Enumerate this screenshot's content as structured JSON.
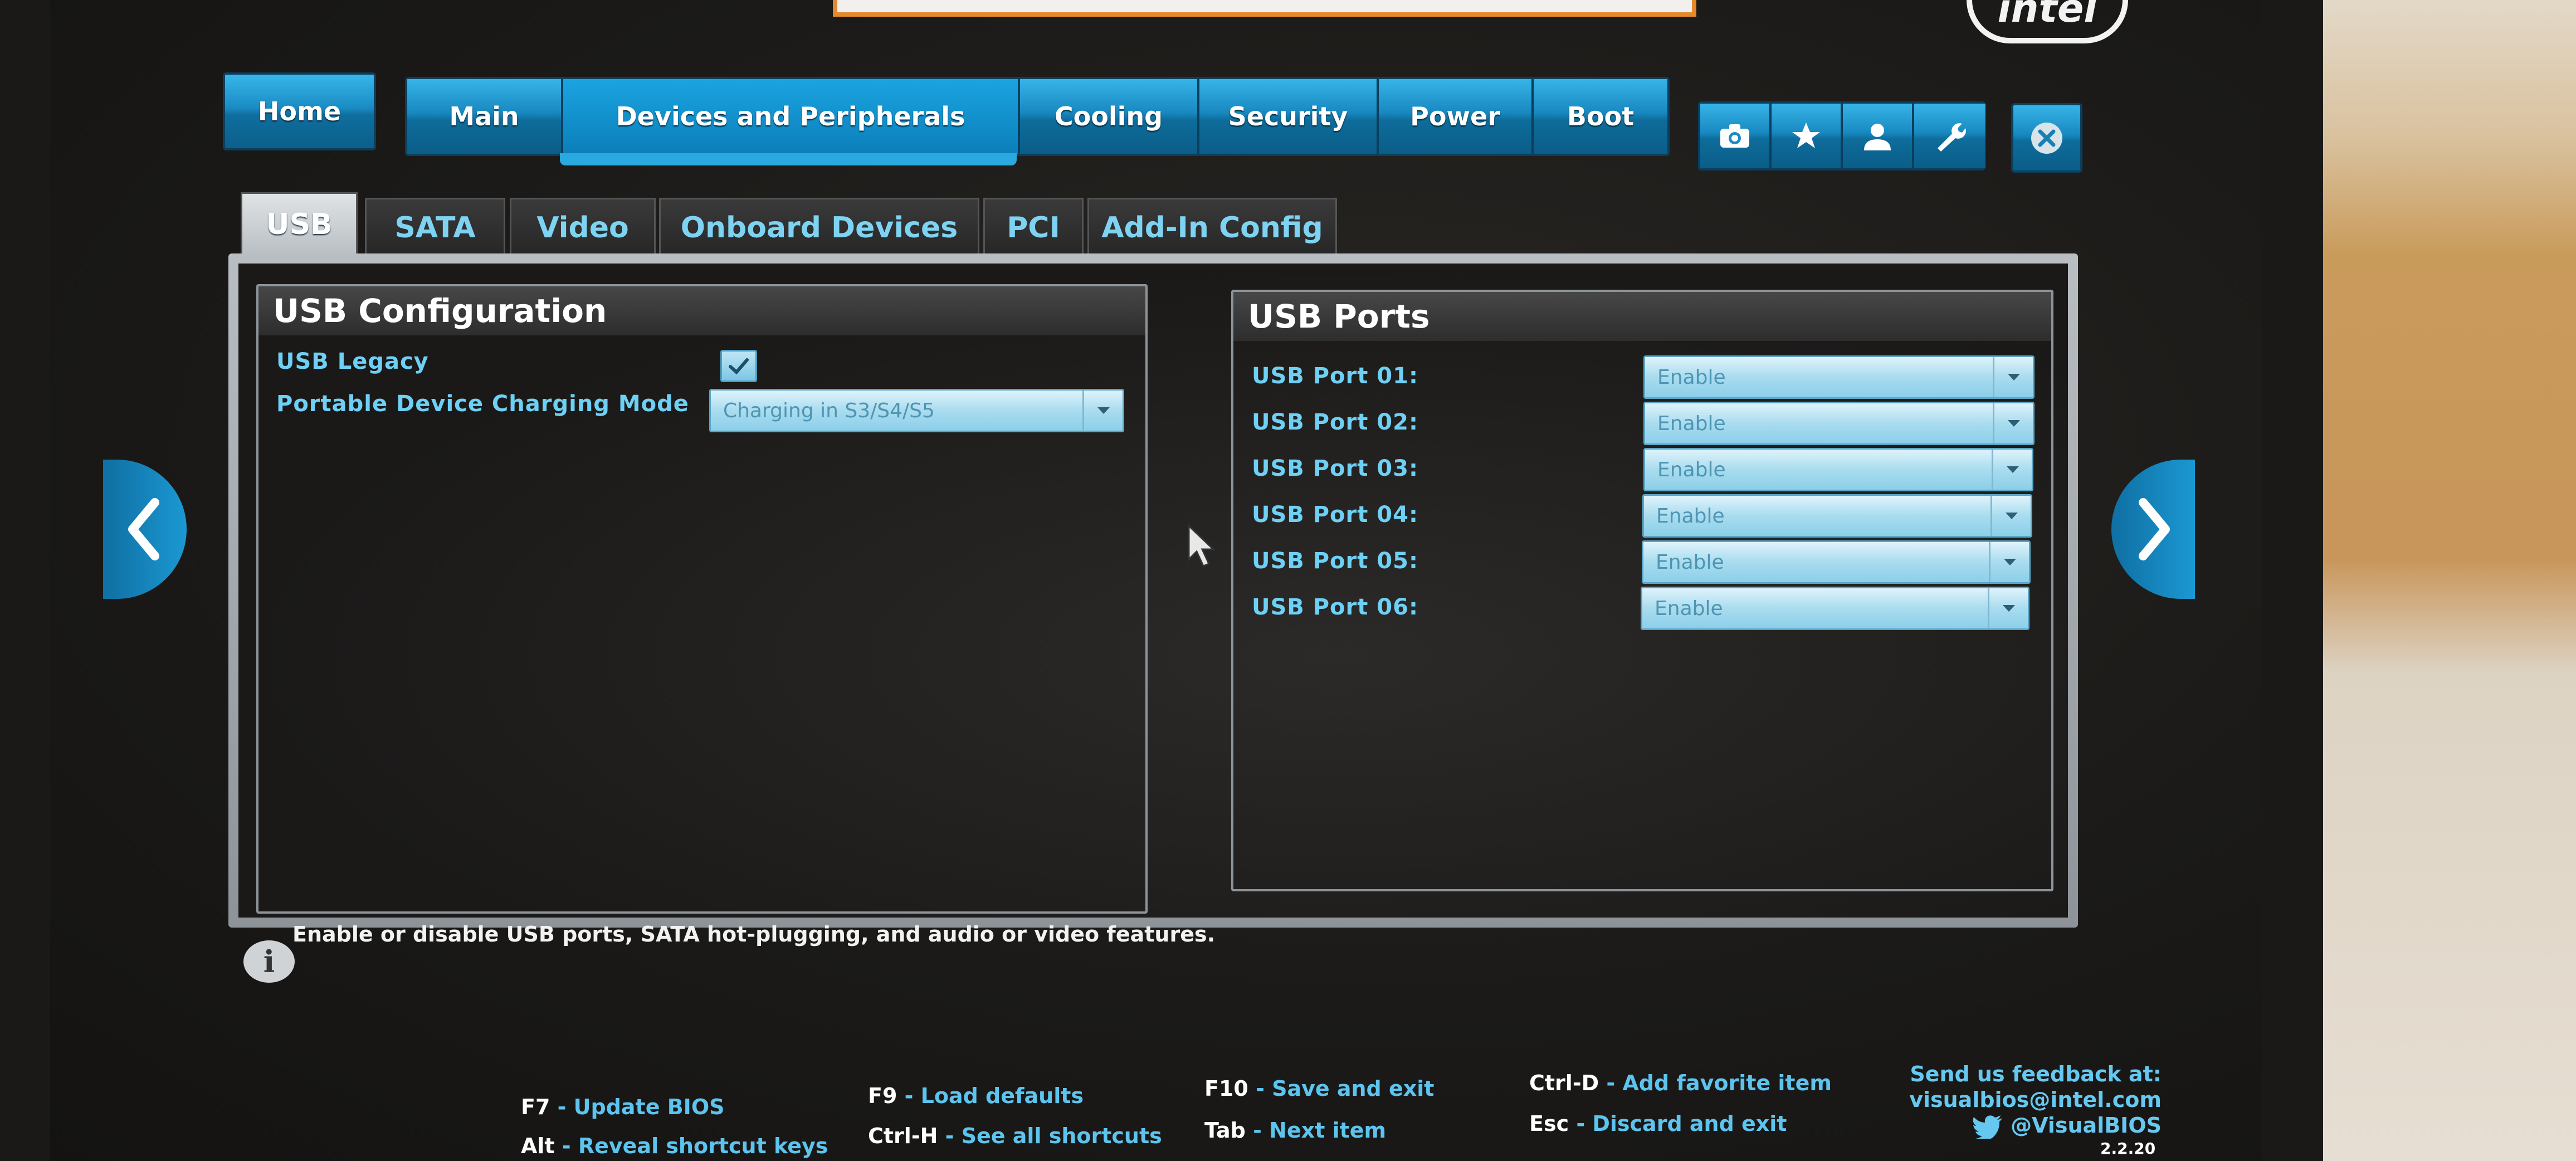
{
  "brand": {
    "logo_text": "intel"
  },
  "nav": {
    "home": "Home",
    "tabs": [
      "Main",
      "Devices and Peripherals",
      "Cooling",
      "Security",
      "Power",
      "Boot"
    ],
    "active_tab": "Devices and Peripherals",
    "icons": [
      "camera-icon",
      "star-icon",
      "user-icon",
      "wrench-icon"
    ],
    "exit_icon": "close-icon"
  },
  "subtabs": {
    "items": [
      "USB",
      "SATA",
      "Video",
      "Onboard Devices",
      "PCI",
      "Add-In Config"
    ],
    "active": "USB"
  },
  "usb_config": {
    "title": "USB Configuration",
    "usb_legacy_label": "USB Legacy",
    "usb_legacy_checked": true,
    "charging_mode_label": "Portable Device Charging Mode",
    "charging_mode_value": "Charging in S3/S4/S5"
  },
  "usb_ports": {
    "title": "USB Ports",
    "ports": [
      {
        "label": "USB Port 01:",
        "value": "Enable"
      },
      {
        "label": "USB Port 02:",
        "value": "Enable"
      },
      {
        "label": "USB Port 03:",
        "value": "Enable"
      },
      {
        "label": "USB Port 04:",
        "value": "Enable"
      },
      {
        "label": "USB Port 05:",
        "value": "Enable"
      },
      {
        "label": "USB Port 06:",
        "value": "Enable"
      }
    ]
  },
  "info": {
    "icon_glyph": "i",
    "text": "Enable or disable USB ports, SATA hot-plugging, and audio or video features."
  },
  "shortcuts": [
    {
      "key": "F7",
      "desc": "- Update BIOS"
    },
    {
      "key": "Alt",
      "desc": "- Reveal shortcut keys"
    },
    {
      "key": "F9",
      "desc": "- Load defaults"
    },
    {
      "key": "Ctrl-H",
      "desc": "- See all shortcuts"
    },
    {
      "key": "F10",
      "desc": "- Save and exit"
    },
    {
      "key": "Tab",
      "desc": "- Next item"
    },
    {
      "key": "Ctrl-D",
      "desc": "- Add favorite item"
    },
    {
      "key": "Esc",
      "desc": "- Discard and exit"
    }
  ],
  "feedback": {
    "line1": "Send us feedback at:",
    "line2": "visualbios@intel.com",
    "line3": "@VisualBIOS"
  },
  "version": "2.2.20",
  "colors": {
    "accent_blue": "#1a8cc4",
    "label_cyan": "#6ed0f5",
    "panel_silver": "#b9bec2"
  }
}
